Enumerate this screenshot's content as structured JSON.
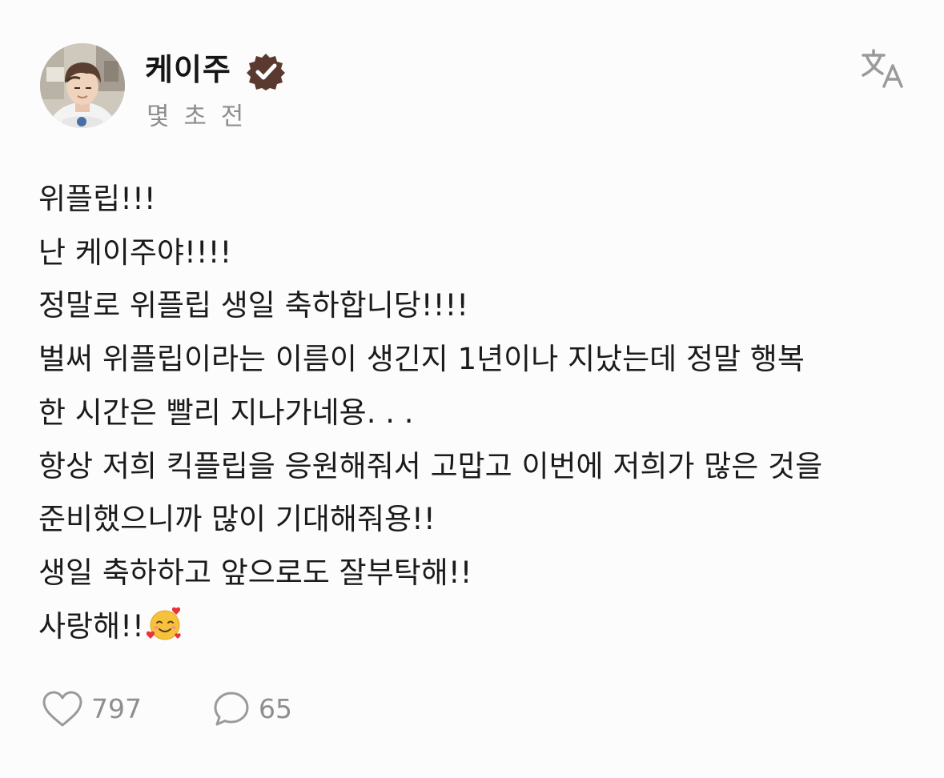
{
  "post": {
    "author": {
      "name": "케이주",
      "verified": true,
      "avatar_icon": "profile-photo"
    },
    "timestamp": "몇 초 전",
    "translate_icon": "translate-icon",
    "body_lines": [
      "위플립!!!",
      "난 케이주야!!!!",
      "정말로 위플립 생일 축하합니당!!!!",
      "벌써 위플립이라는 이름이 생긴지 1년이나 지났는데 정말 행복",
      "한 시간은 빨리 지나가네용. . .",
      "항상 저희 킥플립을 응원해줘서 고맙고 이번에 저희가 많은 것을",
      "준비했으니까 많이 기대해줘용!!",
      "생일 축하하고 앞으로도 잘부탁해!!",
      "사랑해!!"
    ],
    "trailing_emoji": "smiling-face-with-hearts",
    "likes": {
      "icon": "heart-icon",
      "count": "797"
    },
    "comments": {
      "icon": "comment-icon",
      "count": "65"
    }
  },
  "colors": {
    "background": "#fcfcfc",
    "text": "#1b1b1b",
    "muted": "#8e8e8e",
    "verified_badge": "#5a3a2e"
  }
}
